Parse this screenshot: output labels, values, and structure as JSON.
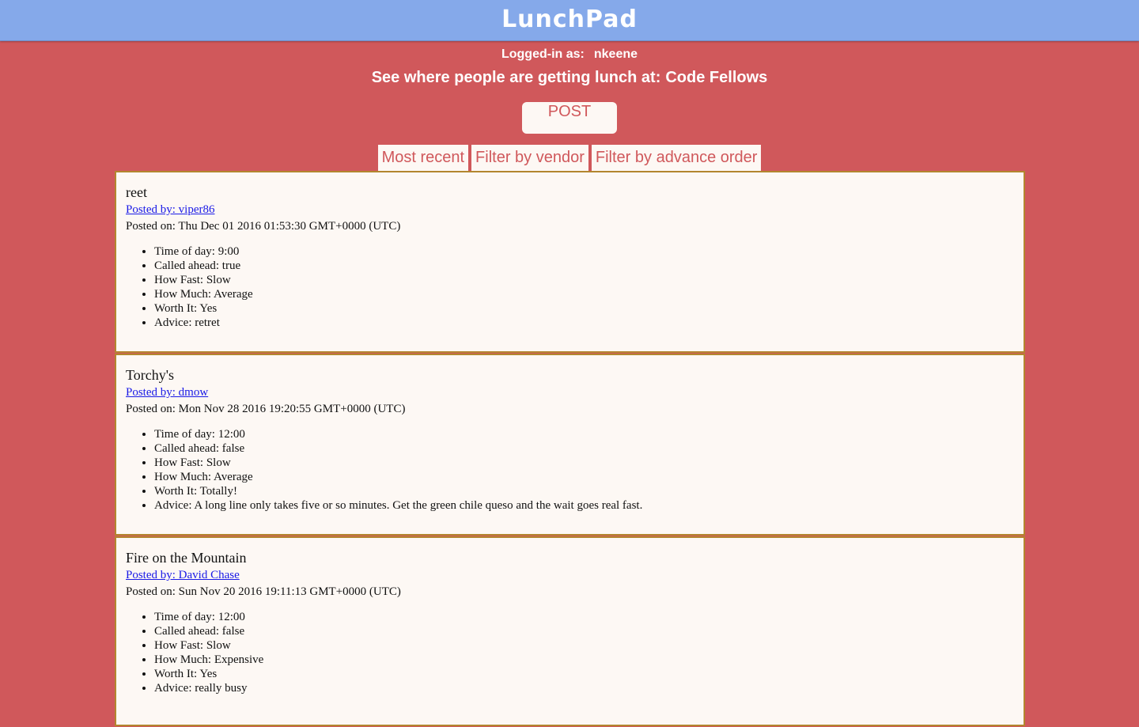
{
  "header": {
    "logo_text": "LunchPad"
  },
  "session": {
    "logged_in_label": "Logged-in as:",
    "username": "nkeene"
  },
  "location": {
    "prompt": "See where people are getting lunch at:",
    "name": "Code Fellows"
  },
  "actions": {
    "post_label": "POST"
  },
  "filters": [
    {
      "label": "Most recent"
    },
    {
      "label": "Filter by vendor"
    },
    {
      "label": "Filter by advance order"
    }
  ],
  "posts": [
    {
      "title": "reet",
      "author": "Posted by: viper86",
      "date": "Posted on: Thu Dec 01 2016 01:53:30 GMT+0000 (UTC)",
      "details": [
        "Time of day: 9:00",
        "Called ahead: true",
        "How Fast: Slow",
        "How Much: Average",
        "Worth It: Yes",
        "Advice: retret"
      ]
    },
    {
      "title": "Torchy's",
      "author": "Posted by: dmow",
      "date": "Posted on: Mon Nov 28 2016 19:20:55 GMT+0000 (UTC)",
      "details": [
        "Time of day: 12:00",
        "Called ahead: false",
        "How Fast: Slow",
        "How Much: Average",
        "Worth It: Totally!",
        "Advice: A long line only takes five or so minutes. Get the green chile queso and the wait goes real fast."
      ]
    },
    {
      "title": "Fire on the Mountain",
      "author": "Posted by: David Chase",
      "date": "Posted on: Sun Nov 20 2016 19:11:13 GMT+0000 (UTC)",
      "details": [
        "Time of day: 12:00",
        "Called ahead: false",
        "How Fast: Slow",
        "How Much: Expensive",
        "Worth It: Yes",
        "Advice: really busy"
      ]
    }
  ],
  "colors": {
    "header_bg": "#85a9ea",
    "page_bg": "#d0585b",
    "card_bg": "#fdf8f4",
    "card_border": "#b3862e",
    "link": "#1a1ae6"
  }
}
